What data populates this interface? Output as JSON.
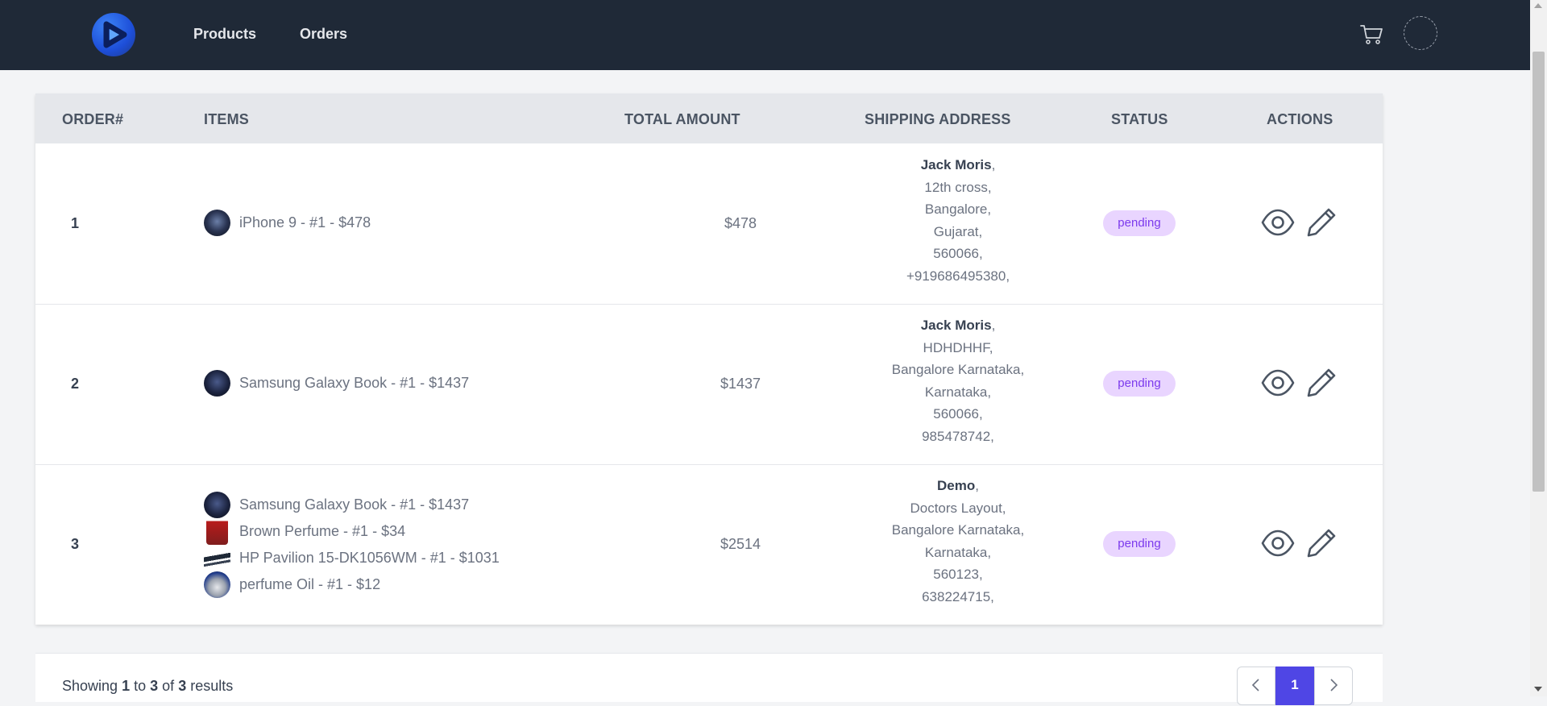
{
  "nav": {
    "links": [
      "Products",
      "Orders"
    ],
    "cart_icon": "cart-icon",
    "avatar": "avatar"
  },
  "table": {
    "headers": [
      "ORDER#",
      "ITEMS",
      "TOTAL AMOUNT",
      "SHIPPING ADDRESS",
      "STATUS",
      "ACTIONS"
    ],
    "rows": [
      {
        "order": "1",
        "items": [
          "iPhone 9 - #1 - $478"
        ],
        "amount": "$478",
        "address": {
          "name": "Jack Moris",
          "lines": [
            "12th cross,",
            "Bangalore,",
            "Gujarat,",
            "560066,",
            "+919686495380,"
          ]
        },
        "status": "pending"
      },
      {
        "order": "2",
        "items": [
          "Samsung Galaxy Book - #1 - $1437"
        ],
        "amount": "$1437",
        "address": {
          "name": "Jack Moris",
          "lines": [
            "HDHDHHF,",
            "Bangalore Karnataka,",
            "Karnataka,",
            "560066,",
            "985478742,"
          ]
        },
        "status": "pending"
      },
      {
        "order": "3",
        "items": [
          "Samsung Galaxy Book - #1 - $1437",
          "Brown Perfume - #1 - $34",
          "HP Pavilion 15-DK1056WM - #1 - $1031",
          "perfume Oil - #1 - $12"
        ],
        "amount": "$2514",
        "address": {
          "name": "Demo",
          "lines": [
            "Doctors Layout,",
            "Bangalore Karnataka,",
            "Karnataka,",
            "560123,",
            "638224715,"
          ]
        },
        "status": "pending"
      }
    ]
  },
  "pagination": {
    "showing_prefix": "Showing",
    "from": "1",
    "to_word": "to",
    "to": "3",
    "of_word": "of",
    "total": "3",
    "results_word": "results",
    "current_page": "1",
    "prev_icon": "chevron-left-icon",
    "next_icon": "chevron-right-icon"
  },
  "colors": {
    "navbar": "#1f2937",
    "badge_bg": "#e9d5ff",
    "badge_text": "#7c3aed",
    "page_active": "#4f46e5"
  }
}
